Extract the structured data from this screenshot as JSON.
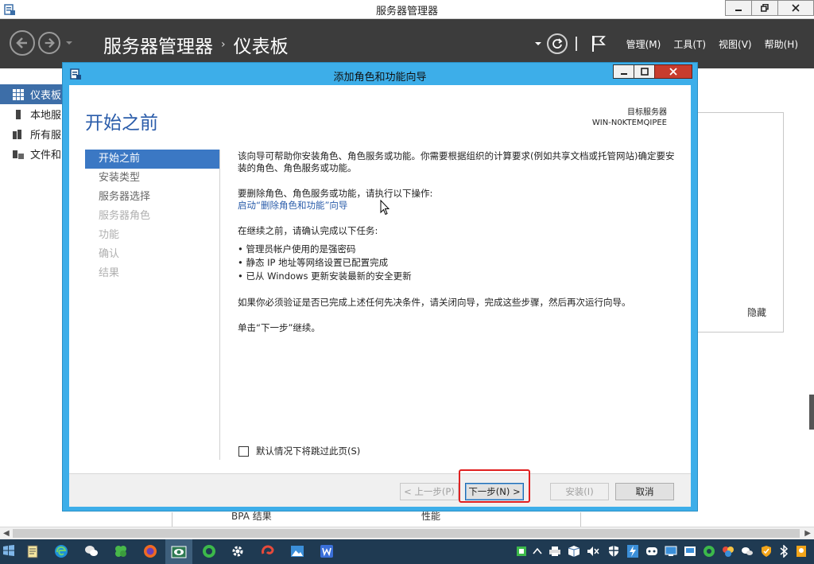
{
  "window": {
    "title": "服务器管理器"
  },
  "header": {
    "app_name": "服务器管理器",
    "separator": "›",
    "page": "仪表板",
    "menus": [
      "管理(M)",
      "工具(T)",
      "视图(V)",
      "帮助(H)"
    ]
  },
  "sidebar": {
    "items": [
      {
        "label": "仪表板",
        "active": true
      },
      {
        "label": "本地服",
        "active": false
      },
      {
        "label": "所有服",
        "active": false
      },
      {
        "label": "文件和",
        "active": false
      }
    ]
  },
  "background": {
    "hide_label": "隐藏",
    "bpa_label": "BPA 结果",
    "perf_label": "性能"
  },
  "wizard": {
    "title": "添加角色和功能向导",
    "heading": "开始之前",
    "target_label": "目标服务器",
    "target_server": "WIN-N0KTEMQIPEE",
    "steps": [
      {
        "label": "开始之前",
        "state": "active"
      },
      {
        "label": "安装类型",
        "state": "visited"
      },
      {
        "label": "服务器选择",
        "state": "visited"
      },
      {
        "label": "服务器角色",
        "state": "disabled"
      },
      {
        "label": "功能",
        "state": "disabled"
      },
      {
        "label": "确认",
        "state": "disabled"
      },
      {
        "label": "结果",
        "state": "disabled"
      }
    ],
    "intro": "该向导可帮助你安装角色、角色服务或功能。你需要根据组织的计算要求(例如共享文档或托管网站)确定要安装的角色、角色服务或功能。",
    "remove_text": "要删除角色、角色服务或功能，请执行以下操作:",
    "remove_link": "启动“删除角色和功能”向导",
    "confirm_text": "在继续之前，请确认完成以下任务:",
    "tasks": [
      "管理员帐户使用的是强密码",
      "静态 IP 地址等网络设置已配置完成",
      "已从 Windows 更新安装最新的安全更新"
    ],
    "close_note": "如果你必须验证是否已完成上述任何先决条件，请关闭向导，完成这些步骤，然后再次运行向导。",
    "continue_note": "单击“下一步”继续。",
    "skip_label": "默认情况下将跳过此页(S)",
    "buttons": {
      "prev": "< 上一步(P)",
      "next": "下一步(N) >",
      "install": "安装(I)",
      "cancel": "取消"
    }
  },
  "colors": {
    "wizard_frame": "#3daee9",
    "header_bg": "#3c3c3c",
    "heading_blue": "#2a5caa",
    "active_step": "#3b78c4",
    "taskbar": "#1f3a52",
    "highlight": "#e02020"
  }
}
